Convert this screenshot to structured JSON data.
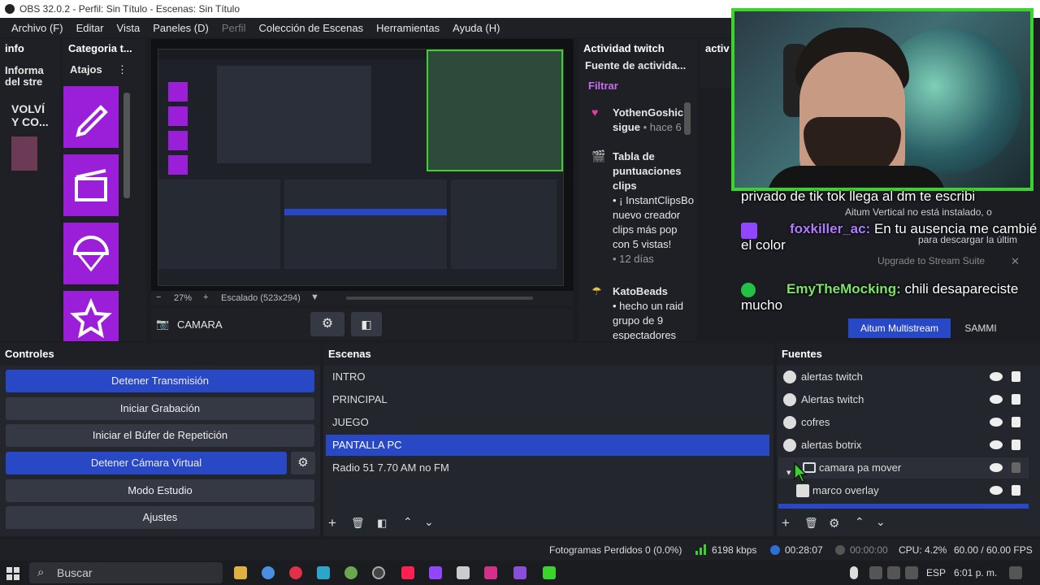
{
  "titlebar": {
    "title": "OBS 32.0.2 - Perfil: Sin Título - Escenas: Sin Título"
  },
  "menu": [
    "Archivo (F)",
    "Editar",
    "Vista",
    "Paneles (D)",
    "Perfil",
    "Colección de Escenas",
    "Herramientas",
    "Ayuda (H)"
  ],
  "docks": {
    "info": {
      "title": "info",
      "text1": "Informa",
      "text2": "del stre",
      "note1": "VOLVÍ",
      "note2": "Y CO..."
    },
    "categoria": {
      "title": "Categoria t...",
      "shortcuts": "Atajos"
    },
    "actividad": {
      "title": "Actividad twitch",
      "feed": "Fuente de activida...",
      "filter": "Filtrar"
    },
    "activ2": {
      "title": "activ"
    }
  },
  "activity": [
    {
      "name": "YothenGoshic",
      "text": "sigue",
      "meta": "• hace 6"
    },
    {
      "name": "Tabla de puntuaciones clips",
      "text": "• ¡ InstantClipsBo nuevo creador clips más pop con 5 vistas!",
      "meta": "• 12 días"
    },
    {
      "name": "KatoBeads",
      "text": "• hecho un raid grupo de 9 espectadores",
      "meta": ""
    }
  ],
  "preview": {
    "zoom": "27%",
    "scale_label": "Escalado (523x294)",
    "source_label": "CAMARA"
  },
  "chat": [
    {
      "user": "",
      "message": "privado de tik tok llega al dm te escribi"
    },
    {
      "user": "foxkiller_ac:",
      "message": "En tu ausencia me cambié el color"
    },
    {
      "user": "EmyTheMocking:",
      "message": "chili desapareciste mucho"
    }
  ],
  "overlay_ui": {
    "note": "Aitum Vertical no está instalado, o",
    "download": "para descargar la últim",
    "upgrade": "Upgrade to Stream Suite",
    "multistream": "Aitum Multistream",
    "sammi": "SAMMI"
  },
  "controls": {
    "title": "Controles",
    "buttons": [
      "Detener Transmisión",
      "Iniciar Grabación",
      "Iniciar el Búfer de Repetición",
      "Detener Cámara Virtual",
      "Modo Estudio",
      "Ajustes"
    ]
  },
  "scenes": {
    "title": "Escenas",
    "items": [
      "INTRO",
      "PRINCIPAL",
      "JUEGO",
      "PANTALLA PC",
      "Radio 51 7.70 AM no FM"
    ],
    "selected": "PANTALLA PC"
  },
  "sources": {
    "title": "Fuentes",
    "items": [
      "alertas twitch",
      "Alertas twitch",
      "cofres",
      "alertas botrix",
      "camara pa mover",
      "marco overlay"
    ]
  },
  "status": {
    "frames": "Fotogramas Perdidos 0 (0.0%)",
    "bitrate": "6198 kbps",
    "live_time": "00:28:07",
    "rec_time": "00:00:00",
    "cpu": "CPU: 4.2%",
    "fps": "60.00 / 60.00 FPS"
  },
  "taskbar": {
    "search_placeholder": "Buscar",
    "lang": "ESP",
    "clock": "6:01 p. m."
  },
  "colors": {
    "accent": "#2848c6",
    "twitch_purple": "#9b1fd9",
    "green_border": "#3ad42c"
  }
}
